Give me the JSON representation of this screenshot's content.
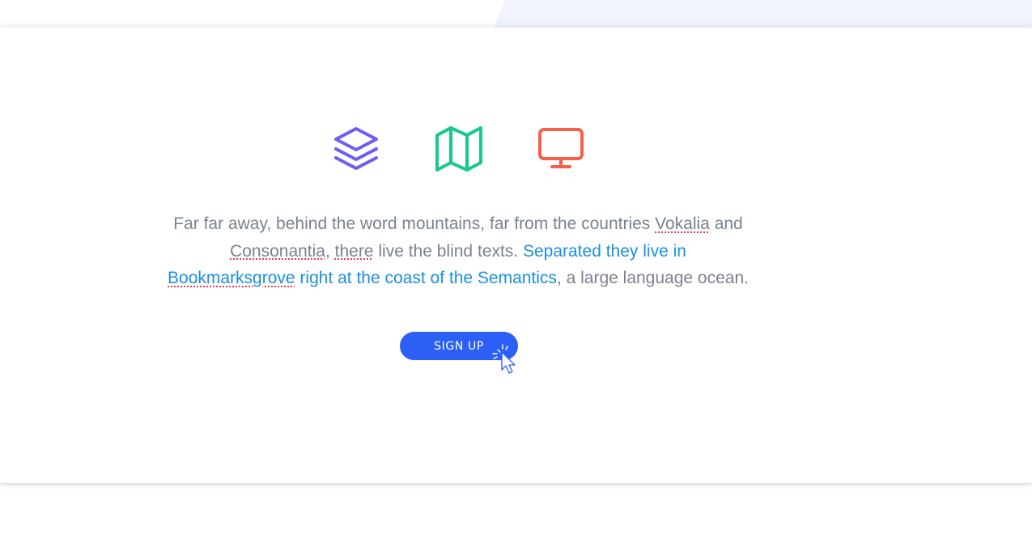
{
  "features": {
    "icons": [
      {
        "name": "layers-icon",
        "color": "#6c5ef3"
      },
      {
        "name": "map-icon",
        "color": "#19c88c"
      },
      {
        "name": "monitor-icon",
        "color": "#f4604a"
      }
    ]
  },
  "intro": {
    "t1": "Far far away, behind the word mountains, far from the countries ",
    "w_vokalia": "Vokalia",
    "t2": " and ",
    "w_consonantia": "Consonantia",
    "t3": ", ",
    "w_there": "there",
    "t4": " live the blind texts. ",
    "link_a": "Separated they live in ",
    "w_bookmarksgrove": "Bookmarksgrove",
    "link_b": " right at the coast of the Semantics",
    "t5": ", a large language ocean."
  },
  "cta": {
    "signup_label": "SIGN UP"
  },
  "colors": {
    "button": "#2b5ff6",
    "link": "#1a8fe0",
    "body_text": "#7b8190"
  }
}
